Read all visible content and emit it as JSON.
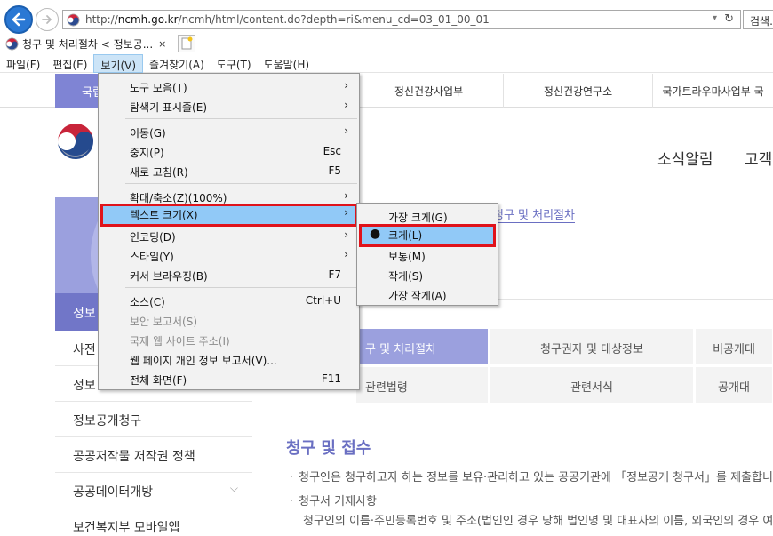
{
  "browser": {
    "url_prefix": "http://",
    "url_host": "ncmh.go.kr",
    "url_path": "/ncmh/html/content.do?depth=ri&menu_cd=03_01_00_01",
    "search_label": "검색...",
    "tab_title": "청구 및 처리절차 < 정보공...",
    "tab_close": "×",
    "dropdown_glyph": "▾",
    "refresh_glyph": "↻"
  },
  "menubar": {
    "items": [
      "파일(F)",
      "편집(E)",
      "보기(V)",
      "즐겨찾기(A)",
      "도구(T)",
      "도움말(H)"
    ],
    "active_index": 2
  },
  "view_menu": {
    "items": [
      {
        "label": "도구 모음(T)",
        "shortcut": "",
        "submenu": true
      },
      {
        "label": "탐색기 표시줄(E)",
        "shortcut": "",
        "submenu": true
      },
      {
        "label": "이동(G)",
        "shortcut": "",
        "submenu": true
      },
      {
        "label": "중지(P)",
        "shortcut": "Esc"
      },
      {
        "label": "새로 고침(R)",
        "shortcut": "F5"
      },
      {
        "label": "확대/축소(Z)(100%)",
        "shortcut": "",
        "submenu": true
      },
      {
        "label": "텍스트 크기(X)",
        "shortcut": "",
        "submenu": true,
        "highlighted": true
      },
      {
        "label": "인코딩(D)",
        "shortcut": "",
        "submenu": true
      },
      {
        "label": "스타일(Y)",
        "shortcut": "",
        "submenu": true
      },
      {
        "label": "커서 브라우징(B)",
        "shortcut": "F7"
      },
      {
        "label": "소스(C)",
        "shortcut": "Ctrl+U"
      },
      {
        "label": "보안 보고서(S)",
        "shortcut": "",
        "disabled": true
      },
      {
        "label": "국제 웹 사이트 주소(I)",
        "shortcut": "",
        "disabled": true
      },
      {
        "label": "웹 페이지 개인 정보 보고서(V)...",
        "shortcut": ""
      },
      {
        "label": "전체 화면(F)",
        "shortcut": "F11"
      }
    ],
    "arrow_glyph": "›"
  },
  "text_size_menu": {
    "items": [
      {
        "label": "가장 크게(G)"
      },
      {
        "label": "크게(L)",
        "checked": true,
        "highlighted": true
      },
      {
        "label": "보통(M)"
      },
      {
        "label": "작게(S)"
      },
      {
        "label": "가장 작게(A)"
      }
    ],
    "bullet_glyph": "●"
  },
  "site": {
    "gnb_first": "국립",
    "gnb": [
      "정신건강사업부",
      "정신건강연구소",
      "국가트라우마사업부"
    ],
    "gnb_tail": "국",
    "topnav": [
      "소식알림",
      "고객"
    ],
    "breadcrumb": "청구 및 처리절차",
    "lnb_active": "정보",
    "lnb": [
      {
        "label": "사전"
      },
      {
        "label": "정보"
      },
      {
        "label": "정보공개청구"
      },
      {
        "label": "공공저작물 저작권 정책"
      },
      {
        "label": "공공데이터개방",
        "chevron": "⌵"
      },
      {
        "label": "보건복지부 모바일앱"
      }
    ],
    "content_tabs_row1": [
      "구 및 처리절차",
      "청구권자 및 대상정보",
      "비공개대"
    ],
    "content_tabs_row2": [
      "관련법령",
      "관련서식",
      "공개대"
    ],
    "section_title": "청구 및 접수",
    "body_lines": [
      {
        "bullet": "·",
        "text": "청구인은 청구하고자 하는 정보를 보유·관리하고 있는 공공기관에 「정보공개 청구서」를 제출합니"
      },
      {
        "bullet": "·",
        "text": "청구서 기재사항"
      },
      {
        "bullet": "",
        "text": "청구인의 이름·주민등록번호 및 주소(법인인 경우 당해 법인명 및 대표자의 이름, 외국인의 경우 여"
      }
    ]
  },
  "colors": {
    "accent": "#7176c8",
    "accent_light": "#9ba0de",
    "highlight": "#91c9f7",
    "red_outline": "#e0131b"
  }
}
